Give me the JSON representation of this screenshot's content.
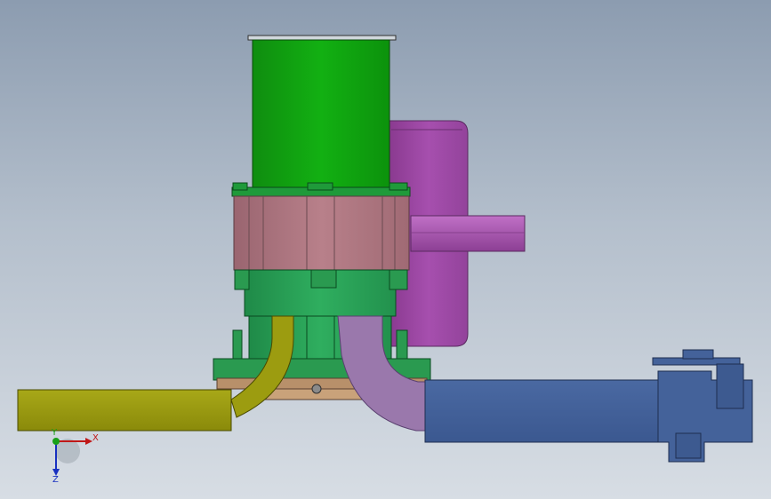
{
  "viewport": {
    "background_top": "#8c9cb0",
    "background_bottom": "#d7dde4"
  },
  "model": {
    "parts": [
      {
        "name": "motor-housing",
        "color": "#0aa00a"
      },
      {
        "name": "gearbox-flange",
        "color": "#b07880"
      },
      {
        "name": "pump-body",
        "color": "#2aa055"
      },
      {
        "name": "intake-impeller-housing",
        "color": "#a04aa8"
      },
      {
        "name": "yellow-pipe",
        "color": "#9c9c10"
      },
      {
        "name": "lavender-pipe",
        "color": "#9a78ac"
      },
      {
        "name": "blue-pipe",
        "color": "#44629a"
      },
      {
        "name": "base-plate",
        "color": "#b8906a"
      }
    ]
  },
  "triad": {
    "x_label": "X",
    "y_label": "Y",
    "z_label": "Z",
    "x_color": "#c01818",
    "y_color": "#18a018",
    "z_color": "#1830c0"
  }
}
